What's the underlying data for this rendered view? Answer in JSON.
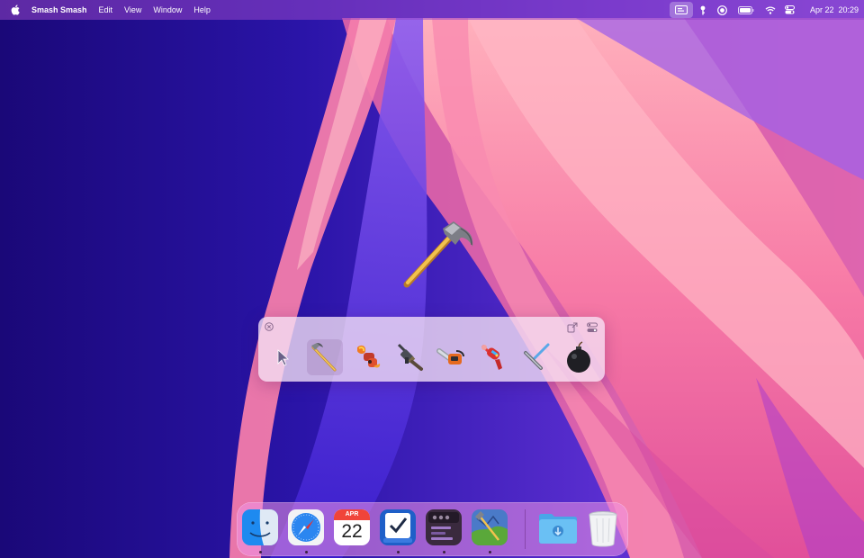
{
  "menubar": {
    "apple_icon": "apple-icon",
    "app_name": "Smash Smash",
    "menus": [
      "Edit",
      "View",
      "Window",
      "Help"
    ],
    "status_icons": [
      "screen-share-icon",
      "key-icon",
      "record-icon",
      "battery-icon",
      "wifi-icon",
      "control-center-icon"
    ],
    "date": "Apr 22",
    "time": "20:29"
  },
  "palette": {
    "icons": [
      "close-icon",
      "share-icon",
      "toggle-icon"
    ],
    "tools": [
      "arrow",
      "hammer",
      "flamethrower",
      "machine-gun",
      "chainsaw",
      "ray-gun",
      "squeegee",
      "bomb"
    ],
    "selected_tool": "hammer"
  },
  "dock": {
    "apps": [
      "Finder",
      "Safari",
      "Calendar",
      "Tasks",
      "Console",
      "Smash Smash"
    ],
    "calendar": {
      "month": "APR",
      "day": "22"
    },
    "right": [
      "Downloads",
      "Trash"
    ]
  },
  "colors": {
    "wallpaper_dark": "#1e0a86",
    "wallpaper_pink": "#f47fa8",
    "accent": "#2b7ff5"
  }
}
